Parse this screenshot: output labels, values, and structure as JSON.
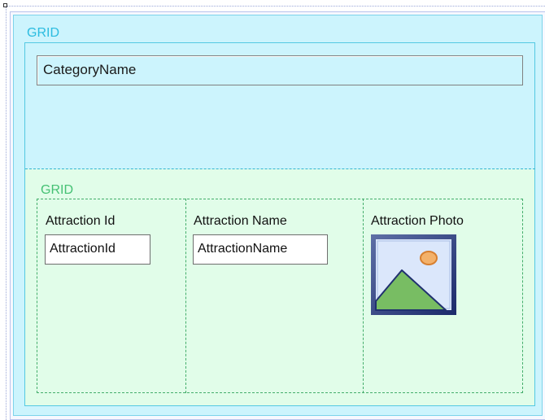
{
  "outer_grid": {
    "label": "GRID",
    "category_field": "CategoryName"
  },
  "inner_grid": {
    "label": "GRID",
    "columns": [
      {
        "header": "Attraction Id",
        "field": "AttractionId"
      },
      {
        "header": "Attraction Name",
        "field": "AttractionName"
      },
      {
        "header": "Attraction Photo",
        "icon": "image-placeholder-icon"
      }
    ]
  },
  "colors": {
    "outer_grid_bg": "#ccf4fd",
    "outer_grid_label": "#2bbce0",
    "inner_grid_bg": "#e1fde9",
    "inner_grid_label": "#45c174"
  }
}
